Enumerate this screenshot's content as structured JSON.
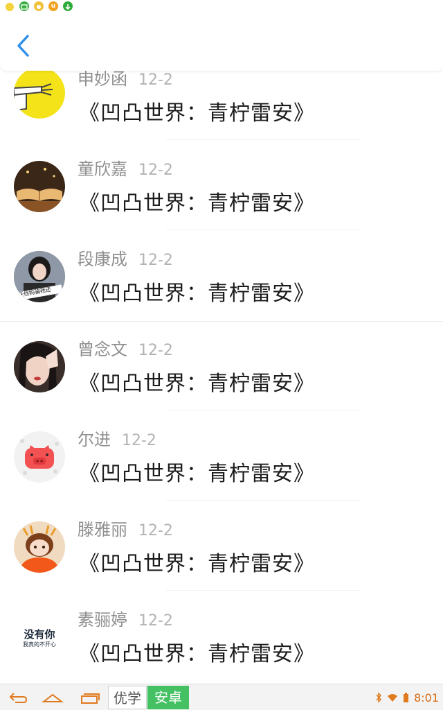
{
  "header": {
    "back_icon": "chevron-left-icon"
  },
  "notifications": [
    {
      "icon": "smiley-icon",
      "color": "#f4d23c"
    },
    {
      "icon": "picture-icon",
      "color": "#3cb043"
    },
    {
      "icon": "coin-icon",
      "color": "#f0c23a"
    },
    {
      "icon": "u-app-icon",
      "color": "#f2a11d",
      "label": "u"
    },
    {
      "icon": "download-icon",
      "color": "#2eaa3b"
    }
  ],
  "items": [
    {
      "name": "申妙函",
      "date": "12-2",
      "title": "《凹凸世界：青柠雷安》",
      "avatar": "pointing-hand-avatar"
    },
    {
      "name": "童欣嘉",
      "date": "12-2",
      "title": "《凹凸世界：青柠雷安》",
      "avatar": "open-book-avatar"
    },
    {
      "name": "段康成",
      "date": "12-2",
      "title": "《凹凸世界：青柠雷安》",
      "avatar": "girl-photo-avatar"
    },
    {
      "name": "曾念文",
      "date": "12-2",
      "title": "《凹凸世界：青柠雷安》",
      "avatar": "girl-portrait-avatar"
    },
    {
      "name": "尔进",
      "date": "12-2",
      "title": "《凹凸世界：青柠雷安》",
      "avatar": "pink-pig-avatar"
    },
    {
      "name": "滕雅丽",
      "date": "12-2",
      "title": "《凹凸世界：青柠雷安》",
      "avatar": "cartoon-girl-avatar"
    },
    {
      "name": "素骊婷",
      "date": "12-2",
      "title": "《凹凸世界：青柠雷安》",
      "avatar": "text-avatar"
    }
  ],
  "avatar_texts": {
    "photo3": "任他妈骗我还",
    "text_big": "没有你",
    "text_small": "我真的不开心"
  },
  "navbar": {
    "ime_left": "优学",
    "ime_right": "安卓",
    "time": "8:01",
    "accent": "#43c163"
  }
}
